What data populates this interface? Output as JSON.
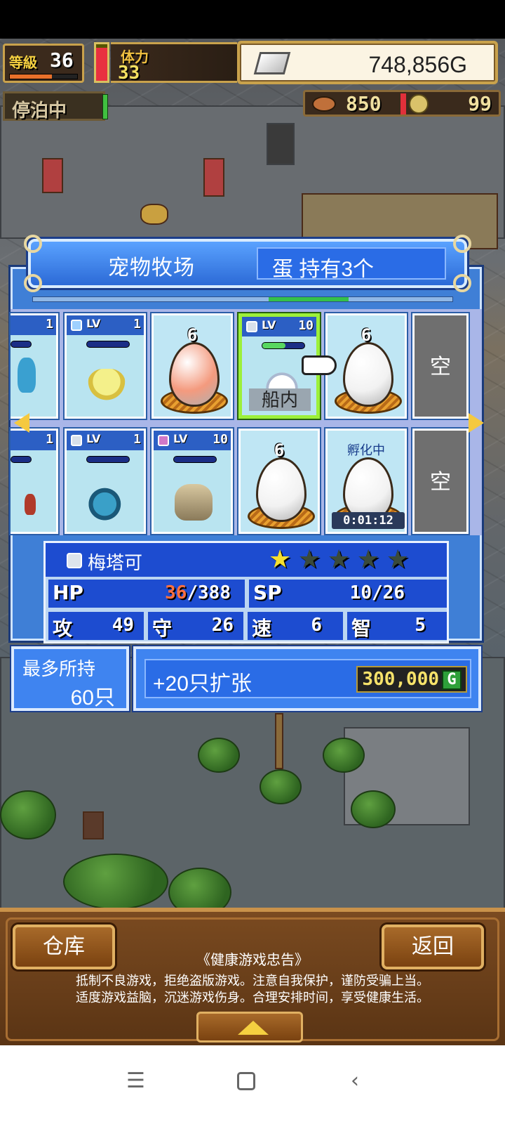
{
  "hud": {
    "level_label": "等級",
    "level": "36",
    "level_progress": 0.62,
    "stamina_label": "体力",
    "stamina": "33",
    "stamina_gauge": 0.9,
    "gold": "748,856G",
    "anchor_status": "停泊中",
    "food": "850",
    "medals": "99"
  },
  "farm": {
    "title": "宠物牧场",
    "eggs_held": "蛋 持有3个",
    "empty_label": "空"
  },
  "slots_row1": [
    {
      "type": "pet",
      "lv_label": "LV",
      "level": "1",
      "gem": "blue",
      "creature": "jellyfish"
    },
    {
      "type": "egg",
      "number": "6",
      "color": "#f49a7e"
    },
    {
      "type": "pet",
      "lv_label": "LV",
      "level": "10",
      "gem": "grey",
      "creature": "rabbit",
      "status": "船内",
      "selected": true
    },
    {
      "type": "egg",
      "number": "6",
      "color": "#f2f2f2"
    }
  ],
  "slots_row2": [
    {
      "type": "pet",
      "lv_label": "LV",
      "level": "1",
      "gem": "grey",
      "creature": "serpent"
    },
    {
      "type": "pet",
      "lv_label": "LV",
      "level": "10",
      "gem": "pink",
      "creature": "mummy"
    },
    {
      "type": "egg",
      "number": "6",
      "color": "#f2f2f2"
    },
    {
      "type": "hatching",
      "label": "孵化中",
      "timer": "0:01:12",
      "color": "#f2f2f2"
    }
  ],
  "partial_left": {
    "row1_level": "1",
    "row2_level": "1"
  },
  "selected_pet": {
    "name": "梅塔可",
    "stars_filled": 1,
    "stars_total": 5,
    "hp_label": "HP",
    "hp_current": "36",
    "hp_max": "/388",
    "sp_label": "SP",
    "sp": "10/26",
    "atk_label": "攻",
    "atk": "49",
    "def_label": "守",
    "def": "26",
    "spd_label": "速",
    "spd": "6",
    "int_label": "智",
    "int": "5"
  },
  "capacity": {
    "label": "最多所持",
    "value": "60只"
  },
  "expand": {
    "label": "+20只扩张",
    "cost": "300,000",
    "cost_unit": "G"
  },
  "bottom": {
    "warehouse": "仓库",
    "back": "返回",
    "notice_title": "《健康游戏忠告》",
    "notice_line1": "抵制不良游戏，拒绝盗版游戏。注意自我保护，谨防受骗上当。",
    "notice_line2": "适度游戏益脑，沉迷游戏伤身。合理安排时间，享受健康生活。"
  },
  "colors": {
    "panel_blue": "#3f7fd6",
    "header_blue": "#1d4cd0",
    "selected_green": "#9cf03a",
    "gold_text": "#f6e26a"
  }
}
